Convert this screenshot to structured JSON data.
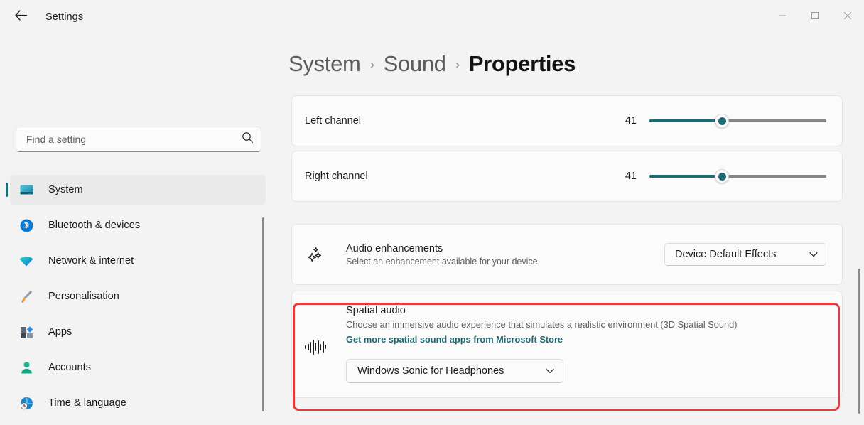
{
  "window": {
    "title": "Settings",
    "back_icon": "arrow-left-icon",
    "minimize_label": "Minimize",
    "maximize_label": "Maximize",
    "close_label": "Close"
  },
  "search": {
    "placeholder": "Find a setting",
    "value": "",
    "icon": "search-icon"
  },
  "sidebar": {
    "items": [
      {
        "label": "System",
        "icon": "monitor-icon",
        "active": true
      },
      {
        "label": "Bluetooth & devices",
        "icon": "bluetooth-icon",
        "active": false
      },
      {
        "label": "Network & internet",
        "icon": "wifi-icon",
        "active": false
      },
      {
        "label": "Personalisation",
        "icon": "paintbrush-icon",
        "active": false
      },
      {
        "label": "Apps",
        "icon": "apps-icon",
        "active": false
      },
      {
        "label": "Accounts",
        "icon": "person-icon",
        "active": false
      },
      {
        "label": "Time & language",
        "icon": "clock-globe-icon",
        "active": false
      }
    ]
  },
  "breadcrumb": {
    "crumb1": "System",
    "separator1": "›",
    "crumb2": "Sound",
    "separator2": "›",
    "current": "Properties"
  },
  "channels": [
    {
      "label": "Left channel",
      "value": "41",
      "percent": 41
    },
    {
      "label": "Right channel",
      "value": "41",
      "percent": 41
    }
  ],
  "audio_enhancements": {
    "icon": "sparkles-icon",
    "title": "Audio enhancements",
    "subtitle": "Select an enhancement available for your device",
    "dropdown_value": "Device Default Effects",
    "chevron": "chevron-down-icon"
  },
  "spatial_audio": {
    "icon": "audio-waveform-icon",
    "title": "Spatial audio",
    "subtitle": "Choose an immersive audio experience that simulates a realistic environment (3D Spatial Sound)",
    "link": "Get more spatial sound apps from Microsoft Store",
    "dropdown_value": "Windows Sonic for Headphones",
    "chevron": "chevron-down-icon",
    "highlighted": true
  },
  "colors": {
    "accent": "#1c6a73",
    "highlight": "#e43d3d",
    "page_bg": "#f3f3f3",
    "card_bg": "#fbfbfb",
    "text": "#1b1b1b",
    "muted_text": "#5d5d5d"
  }
}
